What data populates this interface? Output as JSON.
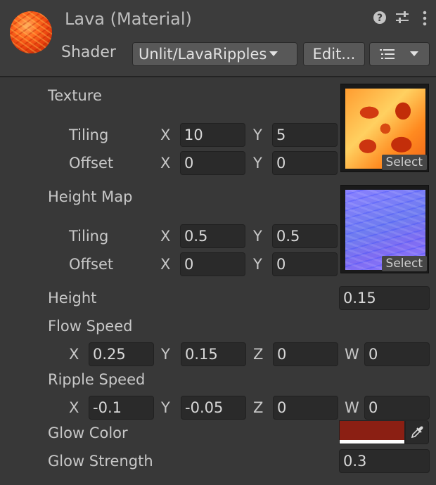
{
  "header": {
    "title": "Lava (Material)",
    "shader_label": "Shader",
    "shader_value": "Unlit/LavaRipples",
    "edit_label": "Edit...",
    "icons": [
      "help-icon",
      "presets-sliders-icon",
      "kebab-menu-icon",
      "list-icon",
      "chevron-down-icon"
    ]
  },
  "texture": {
    "label": "Texture",
    "tiling_label": "Tiling",
    "offset_label": "Offset",
    "tiling_x": "10",
    "tiling_y": "5",
    "offset_x": "0",
    "offset_y": "0",
    "select_label": "Select"
  },
  "height_map": {
    "label": "Height Map",
    "tiling_label": "Tiling",
    "offset_label": "Offset",
    "tiling_x": "0.5",
    "tiling_y": "0.5",
    "offset_x": "0",
    "offset_y": "0",
    "select_label": "Select"
  },
  "axes": {
    "x": "X",
    "y": "Y",
    "z": "Z",
    "w": "W"
  },
  "height": {
    "label": "Height",
    "value": "0.15"
  },
  "flow_speed": {
    "label": "Flow Speed",
    "x": "0.25",
    "y": "0.15",
    "z": "0",
    "w": "0"
  },
  "ripple_speed": {
    "label": "Ripple Speed",
    "x": "-0.1",
    "y": "-0.05",
    "z": "0",
    "w": "0"
  },
  "glow_color": {
    "label": "Glow Color",
    "color": "#8b1f13"
  },
  "glow_strength": {
    "label": "Glow Strength",
    "value": "0.3"
  }
}
